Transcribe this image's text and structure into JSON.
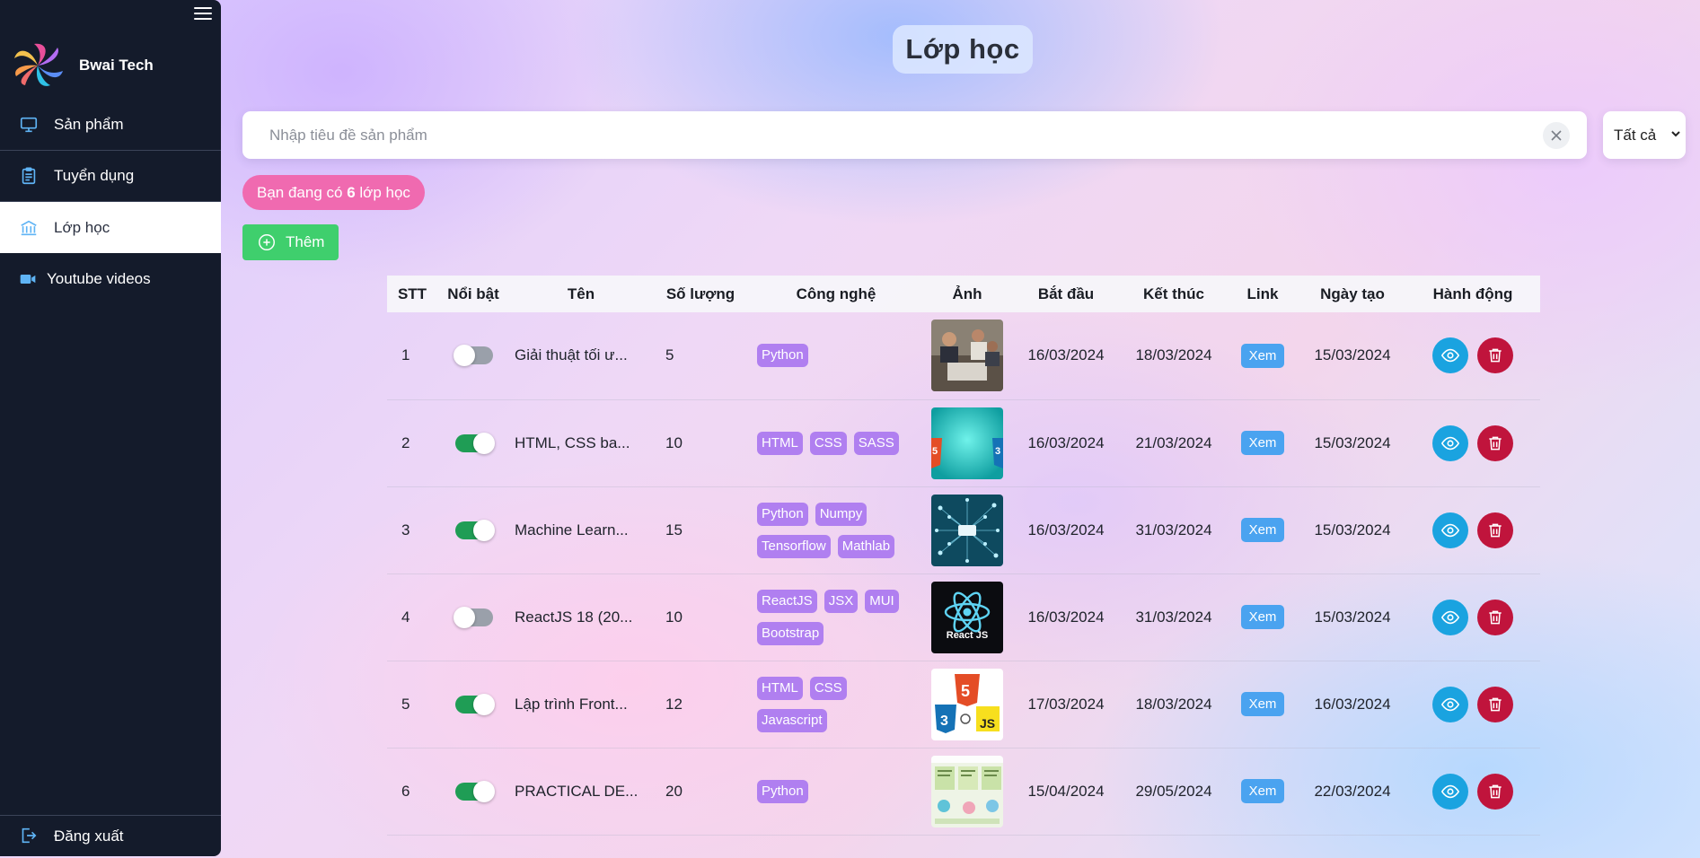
{
  "sidebar": {
    "brand": "Bwai Tech",
    "items": [
      {
        "label": "Sản phẩm",
        "icon": "monitor-icon",
        "active": false
      },
      {
        "label": "Tuyển dụng",
        "icon": "clipboard-icon",
        "active": false
      },
      {
        "label": "Lớp học",
        "icon": "school-icon",
        "active": true
      },
      {
        "label": "Youtube videos",
        "icon": "video-camera-icon",
        "active": false
      }
    ],
    "logout": "Đăng xuất"
  },
  "header": {
    "title": "Lớp học"
  },
  "search": {
    "placeholder": "Nhập tiêu đề sản phẩm",
    "value": ""
  },
  "filter": {
    "selected": "Tất cả"
  },
  "summary": {
    "prefix": "Bạn đang có ",
    "count": "6",
    "suffix": " lớp học"
  },
  "toolbar": {
    "add_label": "Thêm"
  },
  "table": {
    "columns": [
      "STT",
      "Nổi bật",
      "Tên",
      "Số lượng",
      "Công nghệ",
      "Ảnh",
      "Bắt đầu",
      "Kết thúc",
      "Link",
      "Ngày tạo",
      "Hành động"
    ],
    "rows": [
      {
        "stt": "1",
        "featured": false,
        "name": "Giải thuật tối ư...",
        "qty": "5",
        "tech": [
          "Python"
        ],
        "image": "team-photo",
        "start": "16/03/2024",
        "end": "18/03/2024",
        "link": "Xem",
        "created": "15/03/2024"
      },
      {
        "stt": "2",
        "featured": true,
        "name": "HTML, CSS ba...",
        "qty": "10",
        "tech": [
          "HTML",
          "CSS",
          "SASS"
        ],
        "image": "html-css-logos",
        "start": "16/03/2024",
        "end": "21/03/2024",
        "link": "Xem",
        "created": "15/03/2024"
      },
      {
        "stt": "3",
        "featured": true,
        "name": "Machine Learn...",
        "qty": "15",
        "tech": [
          "Python",
          "Numpy",
          "Tensorflow",
          "Mathlab"
        ],
        "image": "neural-network",
        "start": "16/03/2024",
        "end": "31/03/2024",
        "link": "Xem",
        "created": "15/03/2024"
      },
      {
        "stt": "4",
        "featured": false,
        "name": "ReactJS 18 (20...",
        "qty": "10",
        "tech": [
          "ReactJS",
          "JSX",
          "MUI",
          "Bootstrap"
        ],
        "image": "react-logo",
        "image_caption": "React JS",
        "start": "16/03/2024",
        "end": "31/03/2024",
        "link": "Xem",
        "created": "15/03/2024"
      },
      {
        "stt": "5",
        "featured": true,
        "name": "Lập trình Front...",
        "qty": "12",
        "tech": [
          "HTML",
          "CSS",
          "Javascript"
        ],
        "image": "html-css-js-logos",
        "start": "17/03/2024",
        "end": "18/03/2024",
        "link": "Xem",
        "created": "16/03/2024"
      },
      {
        "stt": "6",
        "featured": true,
        "name": "PRACTICAL DE...",
        "qty": "20",
        "tech": [
          "Python"
        ],
        "image": "deep-learning-slide",
        "start": "15/04/2024",
        "end": "29/05/2024",
        "link": "Xem",
        "created": "22/03/2024"
      }
    ]
  },
  "colors": {
    "sidebar_bg": "#141b2b",
    "pill": "#f06ab0",
    "add": "#3fcf6d",
    "tag": "#b07ff0",
    "link": "#4aa3f0",
    "view": "#1aa3e0",
    "delete": "#c0143c",
    "toggle_on": "#1f9d55"
  }
}
